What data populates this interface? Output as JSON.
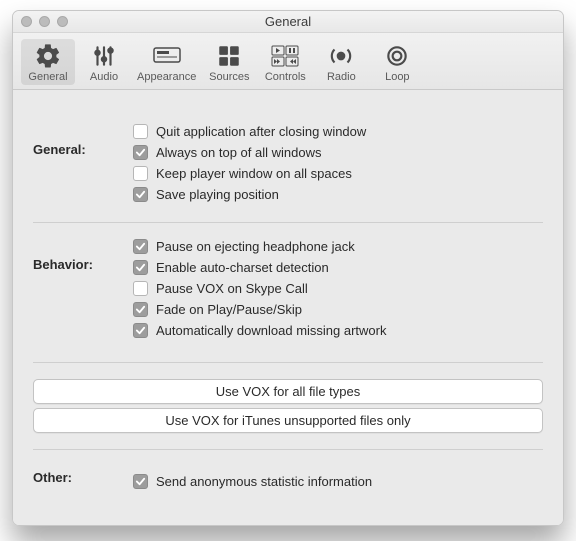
{
  "window": {
    "title": "General"
  },
  "toolbar": {
    "items": [
      {
        "label": "General",
        "name": "tab-general",
        "selected": true
      },
      {
        "label": "Audio",
        "name": "tab-audio",
        "selected": false
      },
      {
        "label": "Appearance",
        "name": "tab-appearance",
        "selected": false
      },
      {
        "label": "Sources",
        "name": "tab-sources",
        "selected": false
      },
      {
        "label": "Controls",
        "name": "tab-controls",
        "selected": false
      },
      {
        "label": "Radio",
        "name": "tab-radio",
        "selected": false
      },
      {
        "label": "Loop",
        "name": "tab-loop",
        "selected": false
      }
    ]
  },
  "sections": {
    "general": {
      "heading": "General:",
      "items": [
        {
          "label": "Quit application after closing window",
          "checked": false
        },
        {
          "label": "Always on top of all windows",
          "checked": true
        },
        {
          "label": "Keep player window on all spaces",
          "checked": false
        },
        {
          "label": "Save playing position",
          "checked": true
        }
      ]
    },
    "behavior": {
      "heading": "Behavior:",
      "items": [
        {
          "label": "Pause on ejecting headphone jack",
          "checked": true
        },
        {
          "label": "Enable auto-charset detection",
          "checked": true
        },
        {
          "label": "Pause VOX on Skype Call",
          "checked": false
        },
        {
          "label": "Fade on Play/Pause/Skip",
          "checked": true
        },
        {
          "label": "Automatically download missing artwork",
          "checked": true
        }
      ]
    },
    "other": {
      "heading": "Other:",
      "items": [
        {
          "label": "Send anonymous statistic information",
          "checked": true
        }
      ]
    }
  },
  "buttons": {
    "all_types": "Use VOX for all file types",
    "itunes_only": "Use VOX for iTunes unsupported files only"
  }
}
